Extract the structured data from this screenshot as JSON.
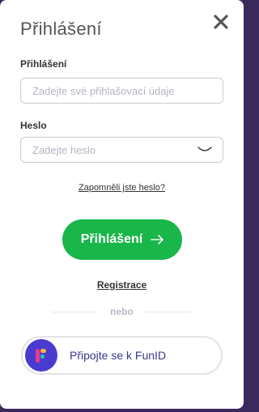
{
  "modal": {
    "title": "Přihlášení"
  },
  "login_field": {
    "label": "Přihlášení",
    "placeholder": "Zadejte své přihlašovací údaje",
    "value": ""
  },
  "password_field": {
    "label": "Heslo",
    "placeholder": "Zadejte heslo",
    "value": ""
  },
  "forgot_password_link": "Zapomněli jste heslo?",
  "login_button": {
    "label": "Přihlášení",
    "icon": "arrow-right-icon"
  },
  "register_link": "Registrace",
  "divider_text": "nebo",
  "funid_button": {
    "label": "Připojte se k FunID",
    "icon": "funid-logo"
  },
  "colors": {
    "primary_green": "#19b64a",
    "funid_purple": "#4a3bd0",
    "text_dark": "#333333"
  }
}
